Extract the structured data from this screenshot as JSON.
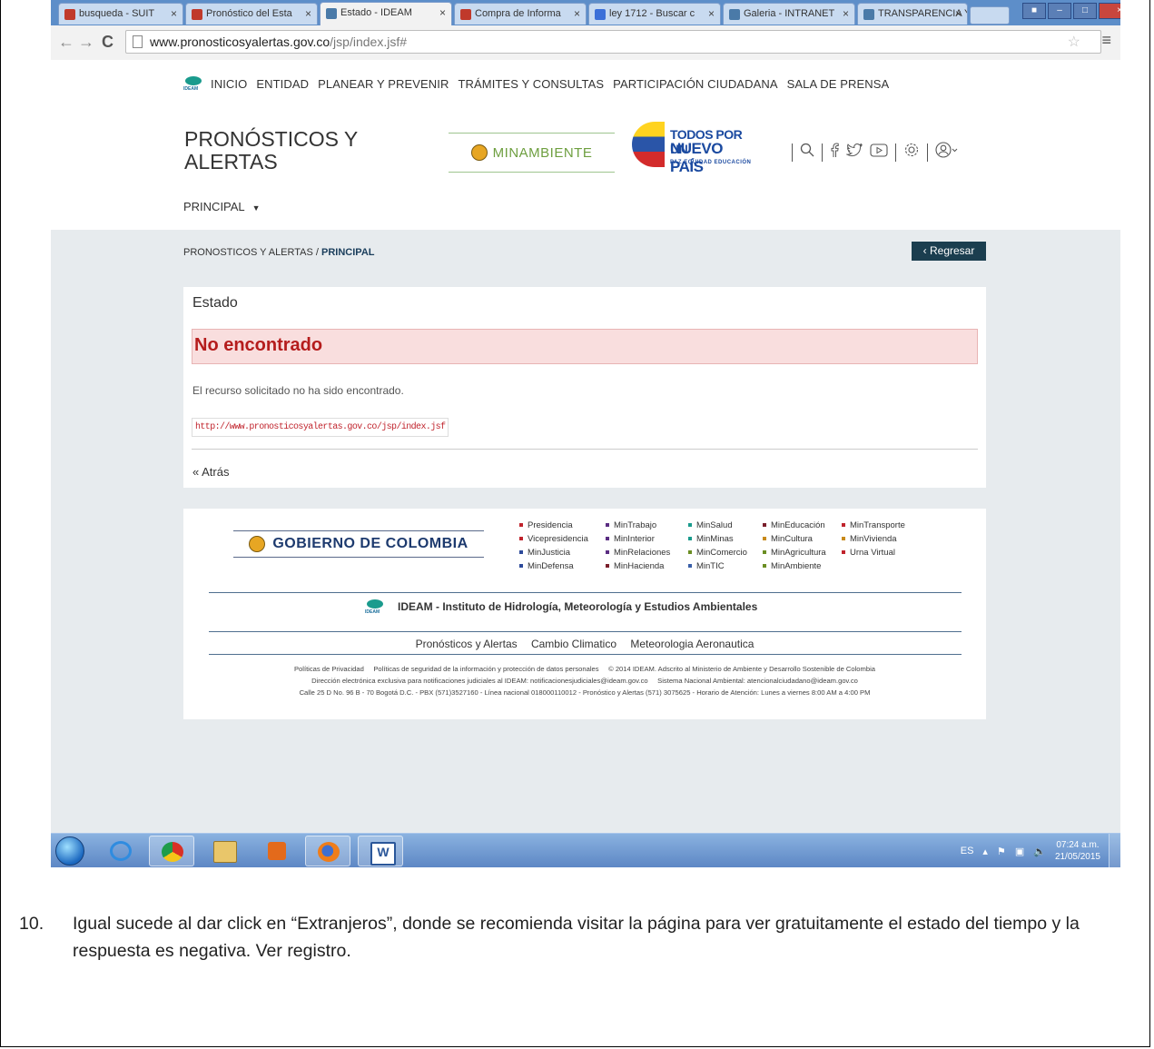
{
  "browser": {
    "tabs": [
      {
        "title": "busqueda - SUIT",
        "icon": "suit-favicon"
      },
      {
        "title": "Pronóstico del Esta",
        "icon": "suit-favicon"
      },
      {
        "title": "Estado - IDEAM",
        "icon": "ideam-favicon"
      },
      {
        "title": "Compra de Informa",
        "icon": "suit-favicon"
      },
      {
        "title": "ley 1712 - Buscar c",
        "icon": "google-favicon"
      },
      {
        "title": "Galeria - INTRANET",
        "icon": "ideam-favicon"
      },
      {
        "title": "TRANSPARENCIA Y",
        "icon": "ideam-favicon"
      }
    ],
    "url_host": "www.pronosticosyalertas.gov.co",
    "url_path": "/jsp/index.jsf#"
  },
  "site": {
    "logo_label": "IDEAM",
    "topnav": [
      "INICIO",
      "ENTIDAD",
      "PLANEAR Y PREVENIR",
      "TRÁMITES Y CONSULTAS",
      "PARTICIPACIÓN CIUDADANA",
      "SALA DE PRENSA"
    ],
    "title": "PRONÓSTICOS Y ALERTAS",
    "minambiente": "MINAMBIENTE",
    "tpp_line1": "TODOS POR UN",
    "tpp_line2": "NUEVO PAÍS",
    "tpp_line3": "PAZ  EQUIDAD  EDUCACIÓN",
    "principal_menu": "PRINCIPAL",
    "breadcrumb_parent": "PRONOSTICOS Y ALERTAS",
    "breadcrumb_sep": " / ",
    "breadcrumb_current": "PRINCIPAL",
    "back_button": "Regresar",
    "back_chevron": "‹"
  },
  "error_card": {
    "heading": "Estado",
    "alert_title": "No encontrado",
    "message": "El recurso solicitado no ha sido encontrado.",
    "requested_url": "http://www.pronosticosyalertas.gov.co/jsp/index.jsf",
    "back_link": "« Atrás"
  },
  "footer": {
    "gobierno": "GOBIERNO DE COLOMBIA",
    "ministries": [
      [
        {
          "name": "Presidencia",
          "color": "#c0232c"
        },
        {
          "name": "Vicepresidencia",
          "color": "#c0232c"
        },
        {
          "name": "MinJusticia",
          "color": "#2d4a9a"
        },
        {
          "name": "MinDefensa",
          "color": "#2d4a9a"
        }
      ],
      [
        {
          "name": "MinTrabajo",
          "color": "#5a2d82"
        },
        {
          "name": "MinInterior",
          "color": "#5a2d82"
        },
        {
          "name": "MinRelaciones",
          "color": "#5a2d82"
        },
        {
          "name": "MinHacienda",
          "color": "#7a1f2b"
        }
      ],
      [
        {
          "name": "MinSalud",
          "color": "#1a9b8d"
        },
        {
          "name": "MinMinas",
          "color": "#1a9b8d"
        },
        {
          "name": "MinComercio",
          "color": "#6b8e23"
        },
        {
          "name": "MinTIC",
          "color": "#3a5fa8"
        }
      ],
      [
        {
          "name": "MinEducación",
          "color": "#7a1f2b"
        },
        {
          "name": "MinCultura",
          "color": "#c88a1a"
        },
        {
          "name": "MinAgricultura",
          "color": "#6b8e23"
        },
        {
          "name": "MinAmbiente",
          "color": "#6b8e23"
        }
      ],
      [
        {
          "name": "MinTransporte",
          "color": "#c0232c"
        },
        {
          "name": "MinVivienda",
          "color": "#c88a1a"
        },
        {
          "name": "Urna Virtual",
          "color": "#c0232c"
        }
      ]
    ],
    "ideam_name": "IDEAM - Instituto de Hidrología, Meteorología y Estudios Ambientales",
    "links": [
      "Pronósticos y Alertas",
      "Cambio Climatico",
      "Meteorologia Aeronautica"
    ],
    "fine_line1": "Políticas de Privacidad     Políticas de seguridad de la información y protección de datos personales     © 2014 IDEAM. Adscrito al Ministerio de Ambiente y Desarrollo Sostenible de Colombia",
    "fine_line2": "Dirección electrónica exclusiva para notificaciones judiciales al IDEAM: notificacionesjudiciales@ideam.gov.co     Sistema Nacional Ambiental: atencionalciudadano@ideam.gov.co",
    "fine_line3": "Calle 25 D No. 96 B - 70 Bogotá D.C. - PBX (571)3527160 - Línea nacional 018000110012 - Pronóstico y Alertas (571) 3075625 - Horario de Atención: Lunes a viernes 8:00 AM a 4:00 PM"
  },
  "taskbar": {
    "language": "ES",
    "time": "07:24 a.m.",
    "date": "21/05/2015"
  },
  "caption": {
    "number": "10.",
    "text": "Igual sucede al dar click en “Extranjeros”, donde se recomienda visitar la página para ver gratuitamente el estado del tiempo y la respuesta es negativa. Ver registro."
  }
}
